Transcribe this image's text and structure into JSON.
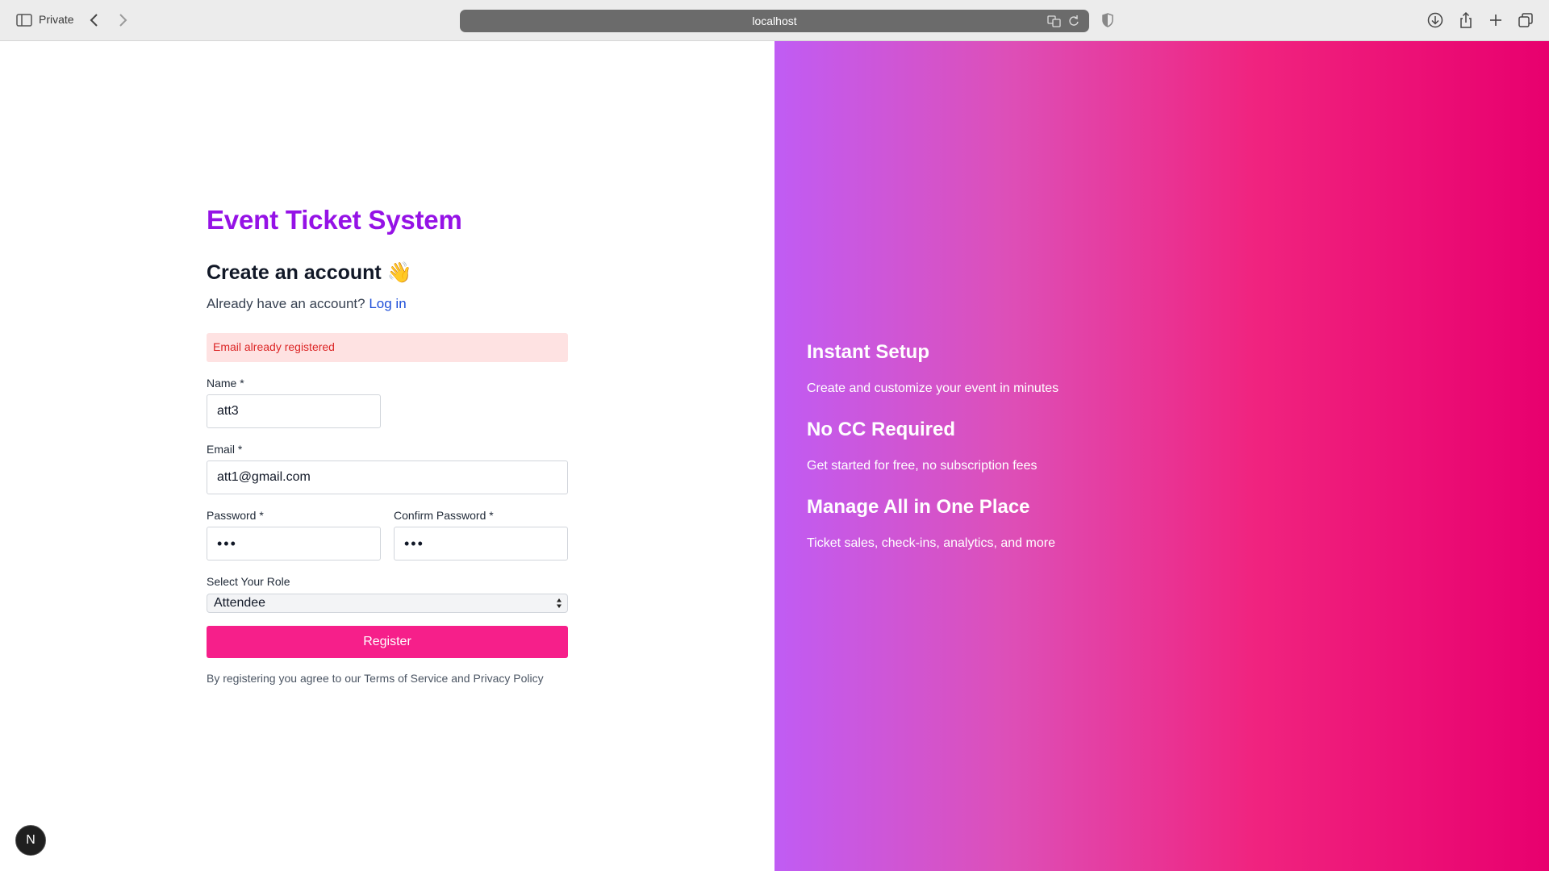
{
  "browser": {
    "private_label": "Private",
    "url": "localhost"
  },
  "brand": {
    "title": "Event Ticket System",
    "color": "#9512e6"
  },
  "signup": {
    "heading": "Create an account 👋",
    "prompt": "Already have an account?",
    "login_link": "Log in",
    "error": "Email already registered",
    "fields": {
      "name": {
        "label": "Name *",
        "value": "att3"
      },
      "email": {
        "label": "Email *",
        "value": "att1@gmail.com"
      },
      "password": {
        "label": "Password *",
        "value": "•••"
      },
      "confirm_password": {
        "label": "Confirm Password *",
        "value": "•••"
      }
    },
    "role": {
      "label": "Select Your Role",
      "selected": "Attendee"
    },
    "register_label": "Register",
    "terms_prefix": "By registering you agree to our",
    "terms_link": "Terms of Service",
    "terms_and": "and",
    "privacy_link": "Privacy Policy",
    "register_color": "#f61f8a"
  },
  "features": [
    {
      "title": "Instant Setup",
      "description": "Create and customize your event in minutes"
    },
    {
      "title": "No CC Required",
      "description": "Get started for free, no subscription fees"
    },
    {
      "title": "Manage All in One Place",
      "description": "Ticket sales, check-ins, analytics, and more"
    }
  ],
  "dev_badge": {
    "letter": "N"
  }
}
